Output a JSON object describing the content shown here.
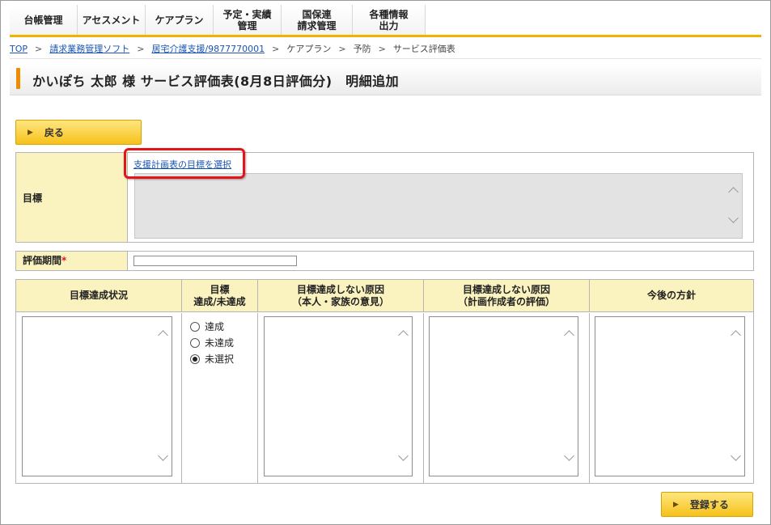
{
  "menu": {
    "tabs": [
      {
        "lines": [
          "台帳管理"
        ]
      },
      {
        "lines": [
          "アセスメント"
        ]
      },
      {
        "lines": [
          "ケアプラン"
        ]
      },
      {
        "lines": [
          "予定・実績",
          "管理"
        ]
      },
      {
        "lines": [
          "国保連",
          "請求管理"
        ]
      },
      {
        "lines": [
          "各種情報",
          "出力"
        ]
      }
    ]
  },
  "breadcrumb": {
    "items": [
      {
        "label": "TOP",
        "link": true
      },
      {
        "label": "請求業務管理ソフト",
        "link": true
      },
      {
        "label": "居宅介護支援/9877770001",
        "link": true
      },
      {
        "label": "ケアプラン",
        "link": false
      },
      {
        "label": "予防",
        "link": false
      },
      {
        "label": "サービス評価表",
        "link": false
      }
    ],
    "separator": ">"
  },
  "page": {
    "title": "かいぽち 太郎 様 サービス評価表(8月8日評価分)　明細追加",
    "accent_color": "#f08a00"
  },
  "buttons": {
    "back_label": "戻る",
    "register_label": "登録する"
  },
  "goal": {
    "label": "目標",
    "select_link": "支援計画表の目標を選択",
    "value": ""
  },
  "period": {
    "label": "評価期間",
    "required_mark": "*",
    "value": ""
  },
  "table": {
    "headers": [
      {
        "lines": [
          "目標達成状況"
        ]
      },
      {
        "lines": [
          "目標",
          "達成/未達成"
        ]
      },
      {
        "lines": [
          "目標達成しない原因",
          "（本人・家族の意見）"
        ]
      },
      {
        "lines": [
          "目標達成しない原因",
          "（計画作成者の評価）"
        ]
      },
      {
        "lines": [
          "今後の方針"
        ]
      }
    ],
    "achievement_options": [
      {
        "label": "達成",
        "selected": false
      },
      {
        "label": "未達成",
        "selected": false
      },
      {
        "label": "未選択",
        "selected": true
      }
    ]
  },
  "colors": {
    "header_bg": "#fbf3bf",
    "button_yellow": "#f6c21a",
    "highlight_red": "#e3151b",
    "link_blue": "#1a55b3"
  }
}
